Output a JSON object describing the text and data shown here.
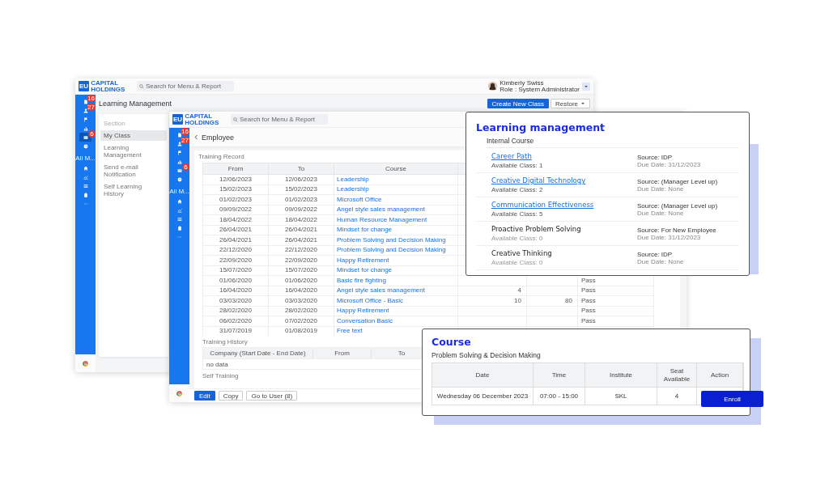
{
  "back_window": {
    "logo": {
      "mark": "EU",
      "name": [
        "CAPITAL",
        "HOLDINGS"
      ]
    },
    "search": {
      "placeholder": "Search for Menu & Report"
    },
    "user": {
      "name": "Kimberly Swiss",
      "role": "Role : System Administrator"
    },
    "sidebar": {
      "items": [
        {
          "badge": "16",
          "selected": false
        },
        {
          "badge": "27",
          "selected": false
        },
        {
          "selected": false
        },
        {
          "selected": false
        },
        {
          "badge": "6",
          "selected": true
        },
        {
          "selected": false
        }
      ],
      "section_label": "All M...",
      "items_2": [
        {
          "selected": false
        },
        {
          "selected": false
        },
        {
          "selected": false
        },
        {
          "selected": false
        }
      ]
    },
    "title": "Learning Management",
    "buttons": [
      {
        "label": "Create New Class",
        "kind": "primary"
      },
      {
        "label": "Restore",
        "kind": "dropdown"
      }
    ],
    "menu": {
      "heading": "Section",
      "items": [
        {
          "label": "My Class",
          "selected": true
        },
        {
          "label": "Learning Management",
          "selected": false
        },
        {
          "label": "Send e-mail Notification",
          "selected": false
        },
        {
          "label": "Self Learning History",
          "selected": false
        }
      ]
    }
  },
  "front_window": {
    "logo": {
      "mark": "EU",
      "name": [
        "CAPITAL",
        "HOLDINGS"
      ]
    },
    "search": {
      "placeholder": "Search for Menu & Report"
    },
    "sidebar": {
      "items": [
        {
          "badge": "16",
          "selected": false
        },
        {
          "badge": "27",
          "selected": false
        },
        {
          "selected": false
        },
        {
          "selected": false
        },
        {
          "badge": "6",
          "selected": false
        },
        {
          "selected": false
        }
      ],
      "section_label": "All M...",
      "items_2": [
        {
          "selected": false
        },
        {
          "selected": false
        },
        {
          "selected": false
        },
        {
          "selected": false
        }
      ]
    },
    "title": "Employee",
    "training_record": {
      "label": "Training Record",
      "columns": [
        "From",
        "To",
        "Course"
      ],
      "rows": [
        {
          "from": "12/06/2023",
          "to": "12/06/2023",
          "course": "Leadership"
        },
        {
          "from": "15/02/2023",
          "to": "15/02/2023",
          "course": "Leadership"
        },
        {
          "from": "01/02/2023",
          "to": "01/02/2023",
          "course": "Microsoft Office"
        },
        {
          "from": "09/09/2022",
          "to": "09/09/2022",
          "course": "Angel style sales management"
        },
        {
          "from": "18/04/2022",
          "to": "18/04/2022",
          "course": "Human Resource Management"
        },
        {
          "from": "26/04/2021",
          "to": "26/04/2021",
          "course": "Mindset for change"
        },
        {
          "from": "26/04/2021",
          "to": "26/04/2021",
          "course": "Problem Solving and Decision Making"
        },
        {
          "from": "22/12/2020",
          "to": "22/12/2020",
          "course": "Problem Solving and Decision Making"
        },
        {
          "from": "22/09/2020",
          "to": "22/09/2020",
          "course": "Happy Retirement"
        },
        {
          "from": "15/07/2020",
          "to": "15/07/2020",
          "course": "Mindset for change"
        },
        {
          "from": "01/06/2020",
          "to": "01/06/2020",
          "course": "Basic fire fighting",
          "column_6": "Pass"
        },
        {
          "from": "16/04/2020",
          "to": "16/04/2020",
          "course": "Angel style sales management",
          "column_4": "4",
          "column_6": "Pass"
        },
        {
          "from": "03/03/2020",
          "to": "03/03/2020",
          "course": "Microsoft Office - Basic",
          "column_4": "10",
          "column_5": "80",
          "column_6": "Pass"
        },
        {
          "from": "28/02/2020",
          "to": "28/02/2020",
          "course": "Happy Retirement",
          "column_6": "Pass"
        },
        {
          "from": "06/02/2020",
          "to": "07/02/2020",
          "course": "Conversation Basic",
          "column_6": "Pass"
        },
        {
          "from": "31/07/2019",
          "to": "01/08/2019",
          "course": "Free text"
        }
      ]
    },
    "training_history": {
      "label": "Training History",
      "columns": [
        "Company (Start Date - End Date)",
        "From",
        "To"
      ],
      "empty_text": "no data"
    },
    "self_training": {
      "label": "Self Training"
    },
    "buttons": [
      {
        "label": "Edit",
        "kind": "primary"
      },
      {
        "label": "Copy",
        "kind": "secondary"
      },
      {
        "label": "Go to User (8)",
        "kind": "secondary"
      }
    ]
  },
  "course_list_card": {
    "title": "Learning management",
    "subtitle": "Internal Course",
    "items": [
      {
        "title": "Career Path",
        "disabled": false,
        "available": "Available Class: 1",
        "source": "Source: IDP",
        "due": "Due Date: 31/12/2023"
      },
      {
        "title": "Creative Digital Technology",
        "disabled": false,
        "available": "Available Class: 2",
        "source": "Source: (Manager Level up)",
        "due": "Due Date: None"
      },
      {
        "title": "Communication Effectiveness",
        "disabled": false,
        "available": "Available Class: 5",
        "source": "Source: (Manager Level up)",
        "due": "Due Date: None"
      },
      {
        "title": "Proactive Problem Solving",
        "disabled": true,
        "available": "Available Class: 0",
        "source": "Source: For New Employee",
        "due": "Due Date:  31/12/2023"
      },
      {
        "title": "Creative Thinking",
        "disabled": true,
        "available": "Available Class: 0",
        "source": "Source: IDP",
        "due": "Due Date: None"
      }
    ]
  },
  "course_card": {
    "title": "Course",
    "subtitle": "Problem Solving & Decision Making",
    "columns": [
      "Date",
      "Time",
      "Institute",
      "Seat Available",
      "Action"
    ],
    "rows": [
      {
        "date": "Wednesday 06 December 2023",
        "time": "07:00 - 15:00",
        "institute": "SKL",
        "seats": "4",
        "action": "Enroll"
      }
    ]
  }
}
